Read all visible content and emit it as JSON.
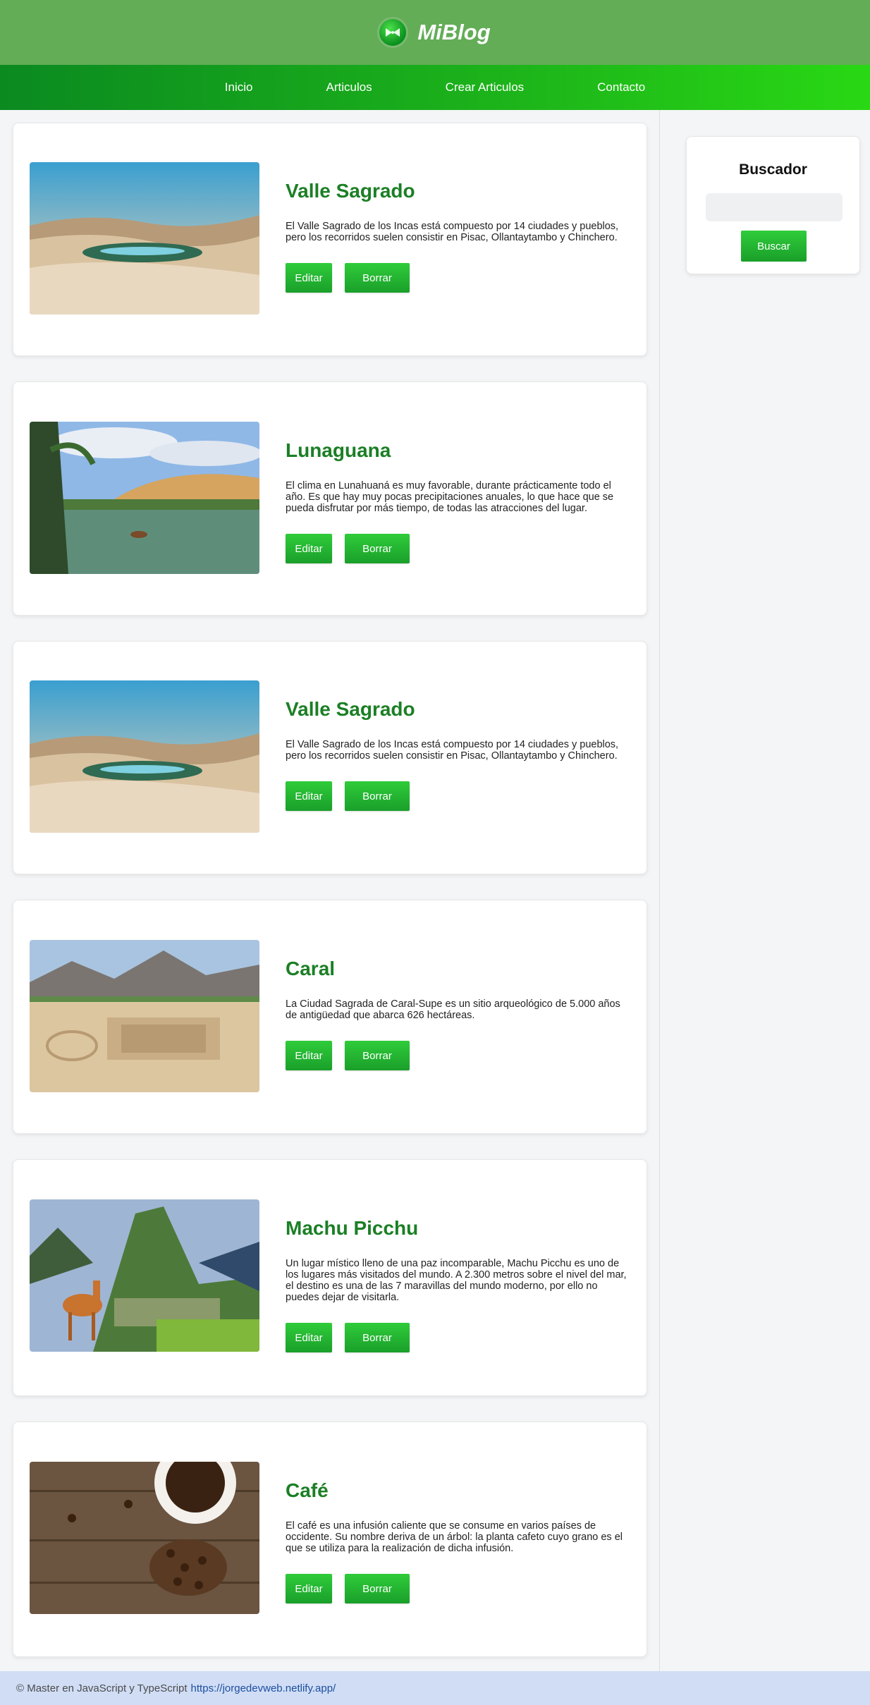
{
  "header": {
    "brand": "MiBlog",
    "logo_icon": "bowtie-logo-icon",
    "bg_color": "#63ad57"
  },
  "nav": {
    "items": [
      {
        "label": "Inicio"
      },
      {
        "label": "Articulos"
      },
      {
        "label": "Crear Articulos"
      },
      {
        "label": "Contacto"
      }
    ]
  },
  "articles": [
    {
      "title": "Valle Sagrado",
      "text": "El Valle Sagrado de los Incas está compuesto por 14 ciudades y pueblos, pero los recorridos suelen consistir en Pisac, Ollantaytambo y Chinchero.",
      "image": "desert-oasis-image",
      "edit_label": "Editar",
      "delete_label": "Borrar"
    },
    {
      "title": "Lunaguana",
      "text": "El clima en Lunahuaná es muy favorable, durante prácticamente todo el año. Es que hay muy pocas precipitaciones anuales, lo que hace que se pueda disfrutar por más tiempo, de todas las atracciones del lugar.",
      "image": "lagoon-palms-image",
      "edit_label": "Editar",
      "delete_label": "Borrar"
    },
    {
      "title": "Valle Sagrado",
      "text": "El Valle Sagrado de los Incas está compuesto por 14 ciudades y pueblos, pero los recorridos suelen consistir en Pisac, Ollantaytambo y Chinchero.",
      "image": "desert-oasis-image",
      "edit_label": "Editar",
      "delete_label": "Borrar"
    },
    {
      "title": "Caral",
      "text": "La Ciudad Sagrada de Caral-Supe es un sitio arqueológico de 5.000 años de antigüedad que abarca 626 hectáreas.",
      "image": "caral-ruins-image",
      "edit_label": "Editar",
      "delete_label": "Borrar"
    },
    {
      "title": "Machu Picchu",
      "text": "Un lugar místico lleno de una paz incomparable, Machu Picchu es uno de los lugares más visitados del mundo. A 2.300 metros sobre el nivel del mar, el destino es una de las 7 maravillas del mundo moderno, por ello no puedes dejar de visitarla.",
      "image": "machu-picchu-llama-image",
      "edit_label": "Editar",
      "delete_label": "Borrar"
    },
    {
      "title": "Café",
      "text": "El café es una infusión caliente que se consume en varios países de occidente. Su nombre deriva de un árbol: la planta cafeto cuyo grano es el que se utiliza para la realización de dicha infusión.",
      "image": "coffee-beans-image",
      "edit_label": "Editar",
      "delete_label": "Borrar"
    }
  ],
  "sidebar": {
    "title": "Buscador",
    "search_placeholder": "",
    "search_button": "Buscar"
  },
  "footer": {
    "text": "© Master en JavaScript y TypeScript",
    "link": "https://jorgedevweb.netlify.app/"
  },
  "colors": {
    "accent": "#1b7f25",
    "button": "#22b02f",
    "footer_bg": "#d0ddf5"
  }
}
